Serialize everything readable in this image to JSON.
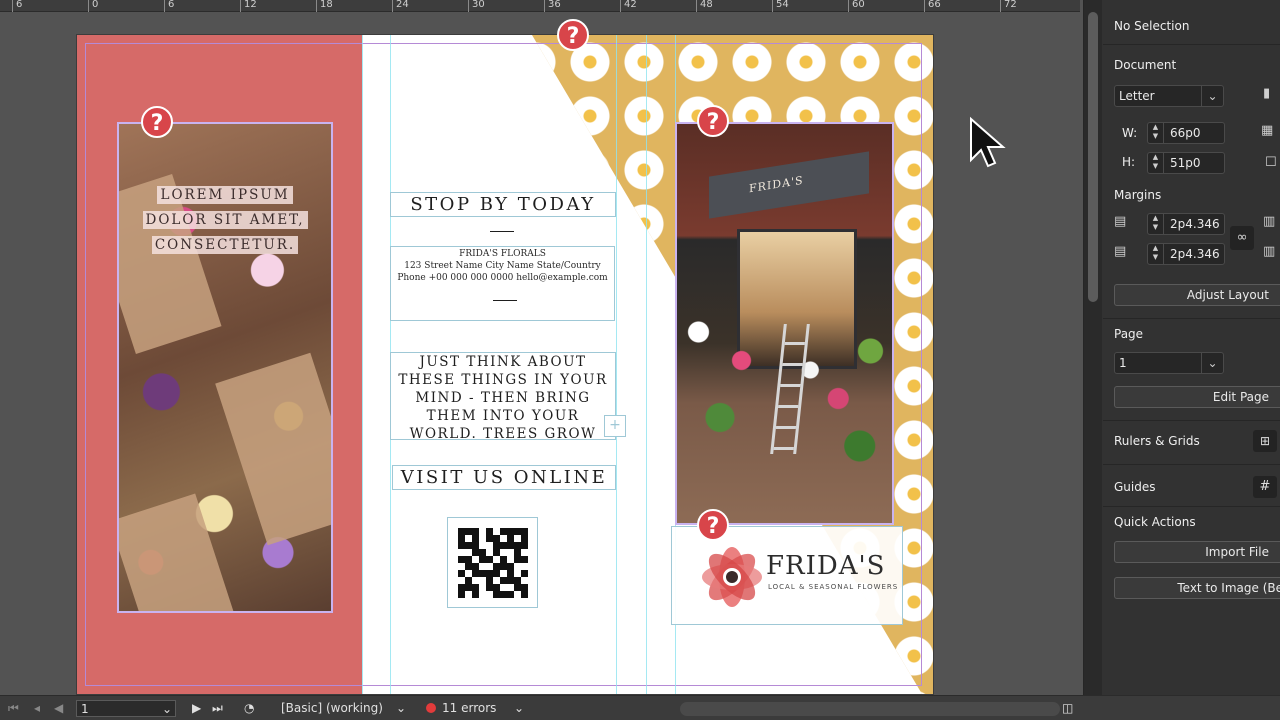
{
  "ruler": {
    "ticks": [
      "6",
      "0",
      "6",
      "12",
      "18",
      "24",
      "30",
      "36",
      "42",
      "48",
      "54",
      "60",
      "66",
      "72"
    ]
  },
  "left_panel": {
    "lorem_lines": [
      "LOREM IPSUM",
      "DOLOR SIT AMET,",
      "CONSECTETUR."
    ]
  },
  "center": {
    "stop_heading": "STOP BY TODAY",
    "business_name": "FRIDA'S FLORALS",
    "address": "123 Street Name City Name State/Country",
    "contact": "Phone +00 000 000 0000 hello@example.com",
    "think_text": "JUST THINK ABOUT THESE THINGS IN YOUR MIND - THEN BRING THEM INTO YOUR WORLD. TREES GROW",
    "visit_heading": "VISIT US ONLINE"
  },
  "right_panel": {
    "shop_sign": "FRIDA'S",
    "logo_title": "FRIDA'S",
    "logo_subtitle": "LOCAL & SEASONAL FLOWERS"
  },
  "error_marker": "?",
  "properties": {
    "selection": "No Selection",
    "document_label": "Document",
    "page_size": "Letter",
    "width_label": "W:",
    "width_value": "66p0",
    "height_label": "H:",
    "height_value": "51p0",
    "margins_label": "Margins",
    "margin_top": "2p4.346",
    "margin_bottom": "2p4.346",
    "adjust_layout": "Adjust Layout",
    "page_label": "Page",
    "page_value": "1",
    "edit_page": "Edit Page",
    "rulers_grids": "Rulers & Grids",
    "guides": "Guides",
    "quick_actions": "Quick Actions",
    "import_file": "Import File",
    "text_to_image": "Text to Image (Be"
  },
  "status": {
    "page_number": "1",
    "profile": "[Basic] (working)",
    "errors": "11 errors"
  },
  "colors": {
    "left_panel": "#d66a68",
    "pattern": "#e0b55f",
    "error_red": "#d8454a",
    "guide_cyan": "#8fe3f0"
  }
}
